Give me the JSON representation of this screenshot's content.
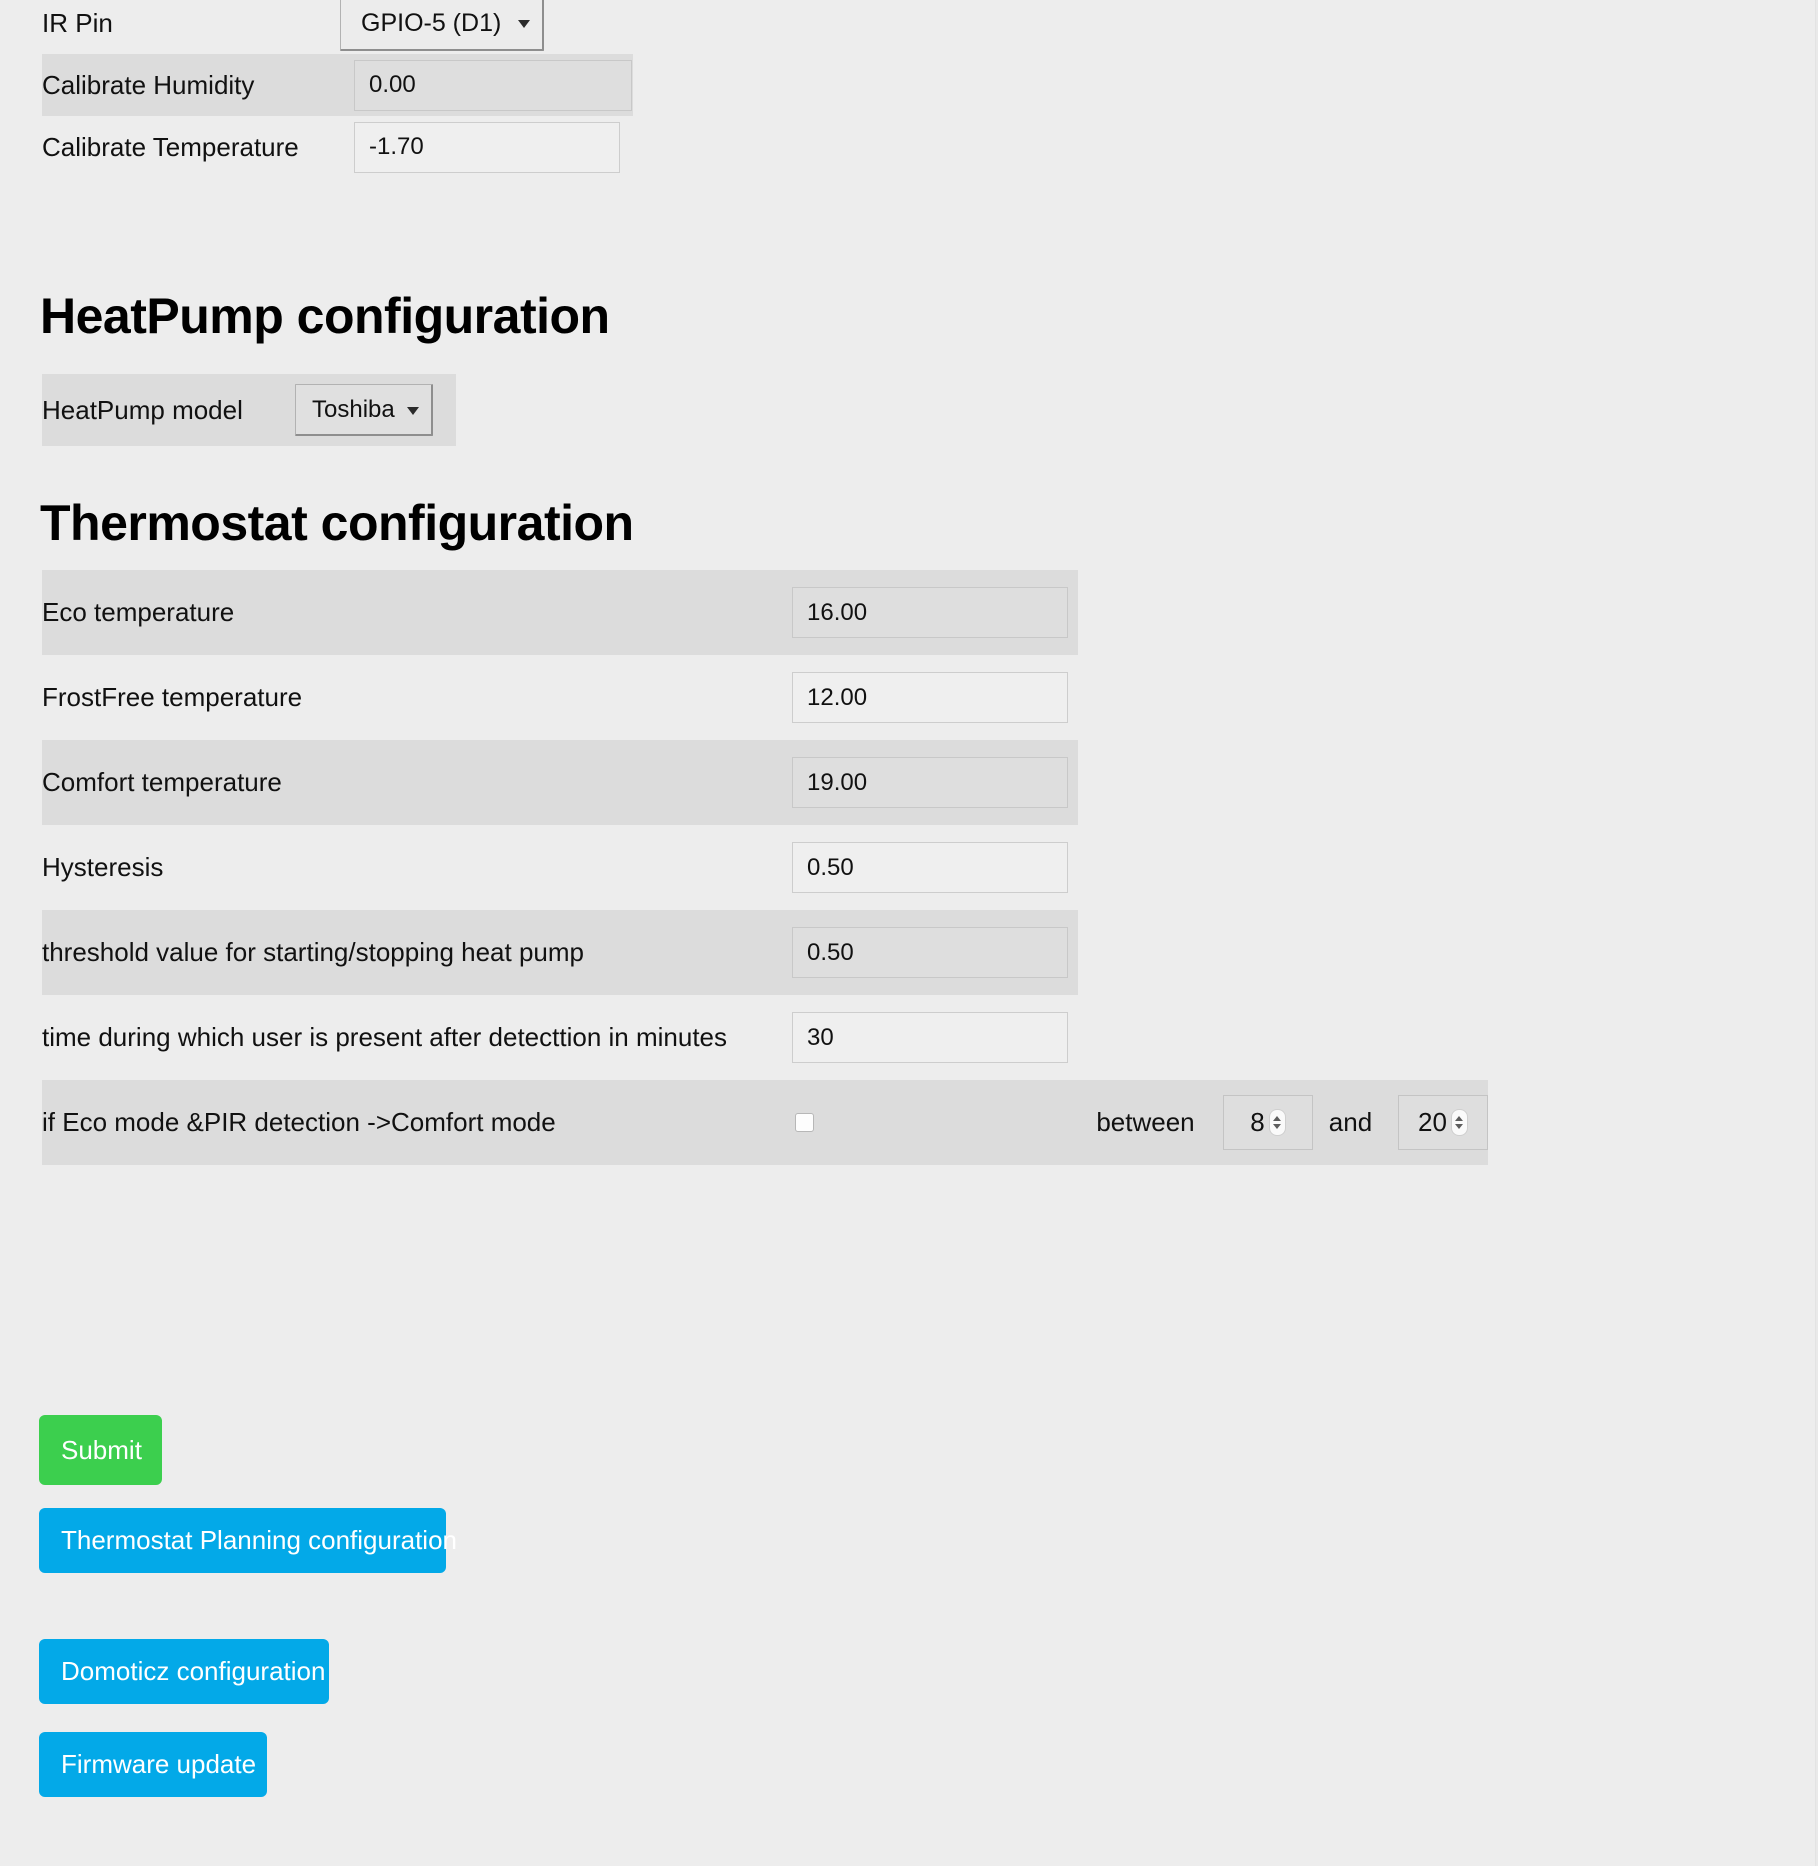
{
  "sensor_section": {
    "rows": [
      {
        "label": "IR Pin",
        "control": "select",
        "value": "GPIO-5 (D1)",
        "options": [
          "GPIO-5 (D1)"
        ],
        "shaded": false
      },
      {
        "label": "Calibrate Humidity",
        "control": "text",
        "value": "0.00",
        "shaded": true
      },
      {
        "label": "Calibrate Temperature",
        "control": "text",
        "value": "-1.70",
        "shaded": false
      }
    ]
  },
  "heatpump_section": {
    "heading": "HeatPump configuration",
    "rows": [
      {
        "label": "HeatPump model",
        "control": "select",
        "value": "Toshiba",
        "options": [
          "Toshiba"
        ],
        "shaded": true
      }
    ]
  },
  "thermostat_section": {
    "heading": "Thermostat configuration",
    "rows": [
      {
        "label": "Eco temperature",
        "value": "16.00",
        "shaded": true
      },
      {
        "label": "FrostFree temperature",
        "value": "12.00",
        "shaded": false
      },
      {
        "label": "Comfort temperature",
        "value": "19.00",
        "shaded": true
      },
      {
        "label": "Hysteresis",
        "value": "0.50",
        "shaded": false
      },
      {
        "label": "threshold value for starting/stopping heat pump",
        "value": "0.50",
        "shaded": true
      },
      {
        "label": "time during which user is present after detecttion in minutes",
        "value": "30",
        "shaded": false
      }
    ],
    "pir_row": {
      "label": "if Eco mode &PIR detection ->Comfort mode",
      "checked": false,
      "between_label": "between",
      "start_hour": "8",
      "and_label": "and",
      "end_hour": "20",
      "shaded": true
    }
  },
  "buttons": {
    "submit": "Submit",
    "planning": "Thermostat Planning configuration",
    "domoticz": "Domoticz configuration",
    "firmware": "Firmware update"
  },
  "colors": {
    "submit_green": "#3ccf4e",
    "link_blue": "#03a9e8",
    "page_bg": "#ededed",
    "row_shade": "#dcdcdc"
  }
}
